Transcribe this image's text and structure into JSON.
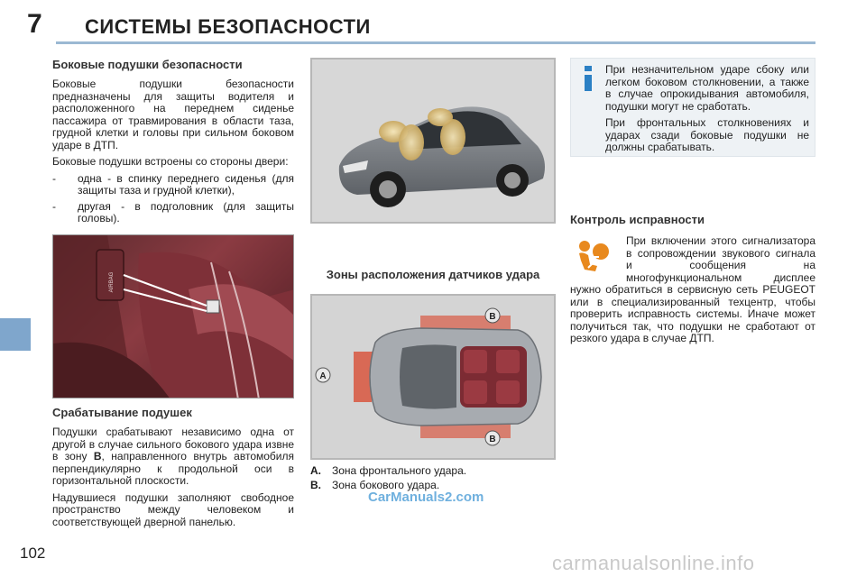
{
  "header": {
    "chapter_number": "7",
    "chapter_title": "СИСТЕМЫ БЕЗОПАСНОСТИ",
    "accent_color": "#9bb9d3",
    "side_tab_color": "#7fa6cc"
  },
  "page_number": "102",
  "side_airbags": {
    "heading": "Боковые подушки безопасности",
    "paragraph1": "Боковые подушки безопасности предназначены для защиты водителя и расположенного на переднем сиденье пассажира от травмирования в области таза, грудной клетки и головы при сильном боковом ударе в ДТП.",
    "paragraph2": "Боковые подушки встроены со стороны двери:",
    "bullets": [
      "одна - в спинку переднего сиденья (для защиты таза и грудной клетки),",
      "другая - в подголовник (для защиты головы)."
    ]
  },
  "seat_photo_tag": "AIRBAG",
  "deployment": {
    "heading": "Срабатывание подушек",
    "paragraph1_before": "Подушки срабатывают независимо одна от другой в случае сильного бокового удара извне в зону ",
    "paragraph1_zone": "B",
    "paragraph1_after": ", направленного внутрь автомобиля перпендикулярно к продольной оси в горизонтальной плоскости.",
    "paragraph2": "Надувшиеся подушки заполняют свободное пространство между человеком и соответствующей дверной панелью."
  },
  "zones": {
    "caption": "Зоны расположения датчиков удара",
    "label_a": "A",
    "label_b": "B",
    "legend": [
      {
        "key": "A.",
        "text": "Зона фронтального удара."
      },
      {
        "key": "B.",
        "text": "Зона бокового удара."
      }
    ]
  },
  "info_box": {
    "icon": "info-icon",
    "paragraph1": "При незначительном ударе сбоку или легком боковом столкновении, а также в случае опрокидывания автомобиля, подушки могут не сработать.",
    "paragraph2": "При фронтальных столкновениях и ударах сзади боковые подушки не должны срабатывать."
  },
  "check": {
    "heading": "Контроль исправности",
    "icon": "airbag-warning-icon",
    "paragraph": "При включении этого сигнализатора в сопровождении звукового сигнала и сообщения на многофункциональном дисплее нужно обратиться в сервисную сеть PEUGEOT или в специализированный техцентр, чтобы проверить исправность системы. Иначе может получиться так, что подушки не сработают от резкого удара в случае ДТП."
  },
  "watermarks": {
    "carmanuals2": "CarManuals2.com",
    "carmanualsonline": "carmanualsonline.info"
  }
}
